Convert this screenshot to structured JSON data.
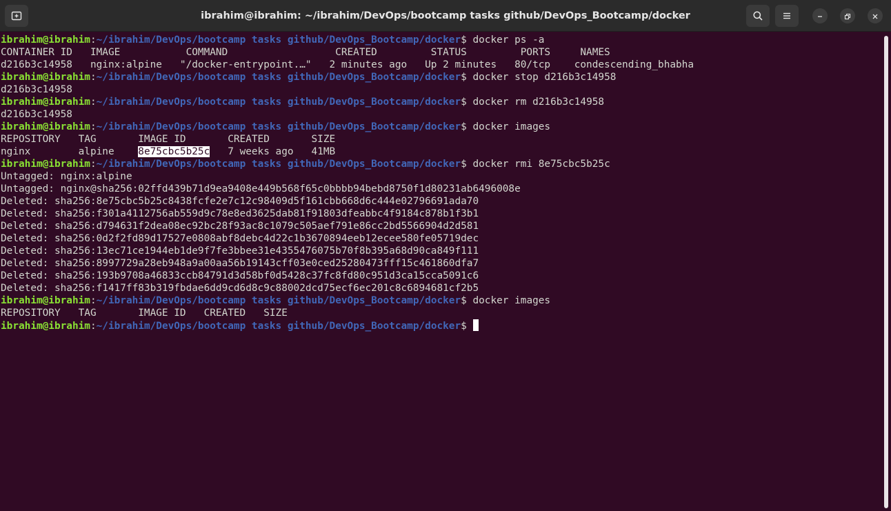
{
  "window": {
    "title": "ibrahim@ibrahim: ~/ibrahim/DevOps/bootcamp tasks github/DevOps_Bootcamp/docker",
    "new_tab_icon": "new-tab-icon",
    "search_icon": "search-icon",
    "menu_icon": "hamburger-menu-icon",
    "minimize_icon": "minimize-icon",
    "maximize_icon": "maximize-icon",
    "close_icon": "close-icon"
  },
  "prompt": {
    "user": "ibrahim@ibrahim",
    "colon": ":",
    "path": "~/ibrahim/DevOps/bootcamp tasks github/DevOps_Bootcamp/docker",
    "dollar": "$ "
  },
  "terminal": {
    "cmd1": "docker ps -a",
    "ps_header": "CONTAINER ID   IMAGE           COMMAND                  CREATED         STATUS         PORTS     NAMES",
    "ps_row": "d216b3c14958   nginx:alpine   \"/docker-entrypoint.…\"   2 minutes ago   Up 2 minutes   80/tcp    condescending_bhabha",
    "cmd2": "docker stop d216b3c14958",
    "out2": "d216b3c14958",
    "cmd3": "docker rm d216b3c14958",
    "out3": "d216b3c14958",
    "cmd4": "docker images",
    "images_header": "REPOSITORY   TAG       IMAGE ID       CREATED       SIZE",
    "images_row_before": "nginx        alpine    ",
    "images_row_selected": "8e75cbc5b25c",
    "images_row_after": "   7 weeks ago   41MB",
    "cmd5": "docker rmi 8e75cbc5b25c",
    "rmi_output": [
      "Untagged: nginx:alpine",
      "Untagged: nginx@sha256:02ffd439b71d9ea9408e449b568f65c0bbbb94bebd8750f1d80231ab6496008e",
      "Deleted: sha256:8e75cbc5b25c8438fcfe2e7c12c98409d5f161cbb668d6c444e02796691ada70",
      "Deleted: sha256:f301a4112756ab559d9c78e8ed3625dab81f91803dfeabbc4f9184c878b1f3b1",
      "Deleted: sha256:d794631f2dea08ec92bc28f93ac8c1079c505aef791e86cc2bd5566904d2d581",
      "Deleted: sha256:0d2f2fd89d17527e0808abf8debc4d22c1b3670894eeb12ecee580fe05719dec",
      "Deleted: sha256:13ec71ce1944eb1de9f7fe3bbee31e4355476075b70f8b395a68d90ca849f111",
      "Deleted: sha256:8997729a28eb948a9a00aa56b19143cff03e0ced25280473fff15c461860dfa7",
      "Deleted: sha256:193b9708a46833ccb84791d3d58bf0d5428c37fc8fd80c951d3ca15cca5091c6",
      "Deleted: sha256:f1417ff83b319fbdae6dd9cd6d8c9c88002dcd75ecf6ec201c8c6894681cf2b5"
    ],
    "cmd6": "docker images",
    "images_header2": "REPOSITORY   TAG       IMAGE ID   CREATED   SIZE"
  },
  "colors": {
    "background": "#300a24",
    "prompt_user": "#8ae234",
    "prompt_path": "#4167b8",
    "text": "#d3d7cf",
    "titlebar": "#2b2b2b"
  }
}
